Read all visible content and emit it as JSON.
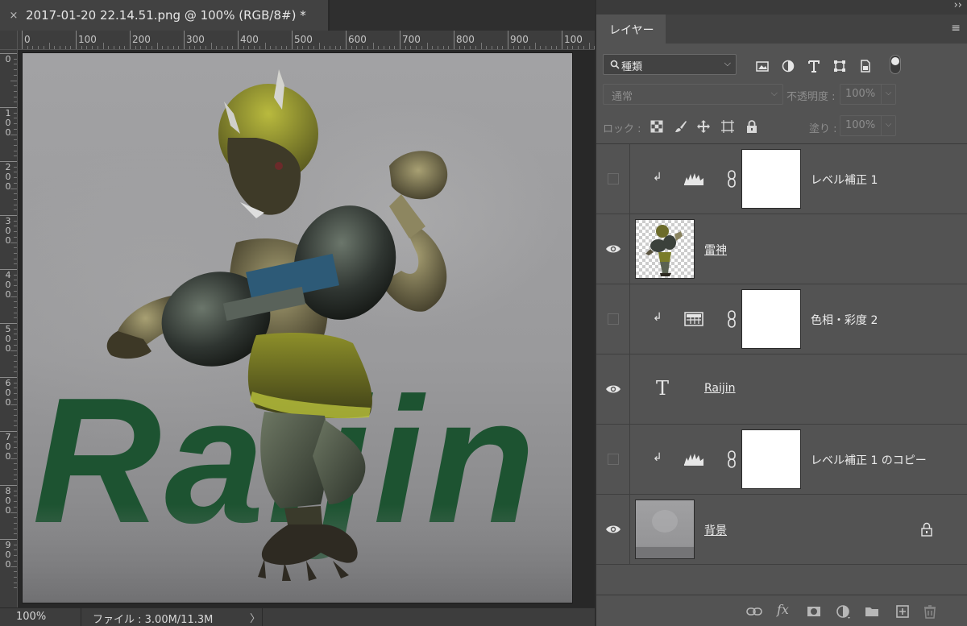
{
  "document": {
    "tab_close": "×",
    "tab_title": "2017-01-20 22.14.51.png @ 100% (RGB/8#) *",
    "ruler_h_labels": [
      "0",
      "100",
      "200",
      "300",
      "400",
      "500",
      "600",
      "700",
      "800",
      "900",
      "100"
    ],
    "ruler_v_labels": [
      "0",
      "1\n0\n0",
      "2\n0\n0",
      "3\n0\n0",
      "4\n0\n0",
      "5\n0\n0",
      "6\n0\n0",
      "7\n0\n0",
      "8\n0\n0",
      "9\n0\n0"
    ],
    "canvas_text": "Raijin",
    "canvas_text_color": "#1d5331",
    "status": {
      "zoom": "100%",
      "file_info": "ファイル : 3.00M/11.3M",
      "arrow": "〉"
    }
  },
  "panel": {
    "collapse": "››",
    "tab_label": "レイヤー",
    "menu_icon": "≡",
    "filter": {
      "kind_label": "種類",
      "icons": [
        "image-filter-icon",
        "adjustment-filter-icon",
        "type-filter-icon",
        "shape-filter-icon",
        "smart-object-filter-icon"
      ]
    },
    "blend_mode": "通常",
    "opacity_label": "不透明度 :",
    "opacity_value": "100%",
    "lock_label": "ロック :",
    "fill_label": "塗り :",
    "fill_value": "100%",
    "layers": [
      {
        "name": "レベル補正 1",
        "visible": false,
        "kind": "levels",
        "clipped": true
      },
      {
        "name": "雷神",
        "visible": true,
        "kind": "pixel",
        "clipped": false
      },
      {
        "name": "色相・彩度 2",
        "visible": false,
        "kind": "hue-saturation",
        "clipped": true
      },
      {
        "name": "Raijin",
        "visible": true,
        "kind": "type",
        "clipped": false
      },
      {
        "name": "レベル補正 1 のコピー",
        "visible": false,
        "kind": "levels",
        "clipped": true
      },
      {
        "name": "背景",
        "visible": true,
        "kind": "background",
        "clipped": false,
        "locked": true
      }
    ],
    "clip_glyph": "↲",
    "type_glyph": "T",
    "bottom_icons": [
      "link-layers-icon",
      "fx-icon",
      "add-mask-icon",
      "new-adjustment-icon",
      "new-group-icon",
      "new-layer-icon",
      "trash-icon"
    ],
    "fx_label": "fx"
  }
}
